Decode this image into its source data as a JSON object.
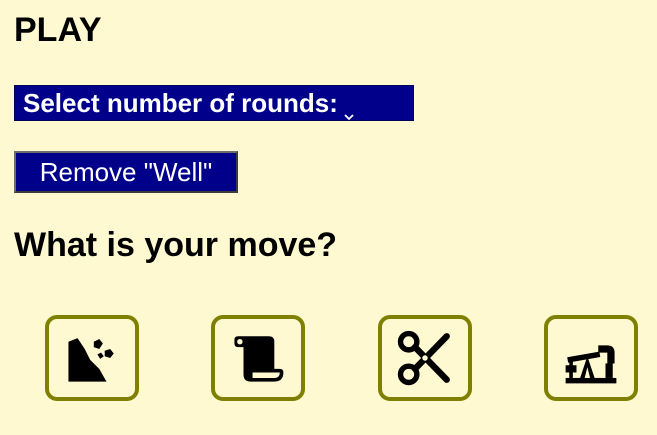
{
  "page": {
    "title": "PLAY"
  },
  "rounds_select": {
    "label": "Select number of rounds:"
  },
  "remove_button": {
    "label": "Remove \"Well\""
  },
  "moves": {
    "heading": "What is your move?",
    "options": [
      {
        "name": "rock",
        "icon": "rock-icon"
      },
      {
        "name": "paper",
        "icon": "scroll-icon"
      },
      {
        "name": "scissors",
        "icon": "scissors-icon"
      },
      {
        "name": "well",
        "icon": "oil-well-icon"
      }
    ]
  },
  "colors": {
    "background": "#fff9d1",
    "control_bg": "#00008b",
    "move_border": "#808000"
  }
}
